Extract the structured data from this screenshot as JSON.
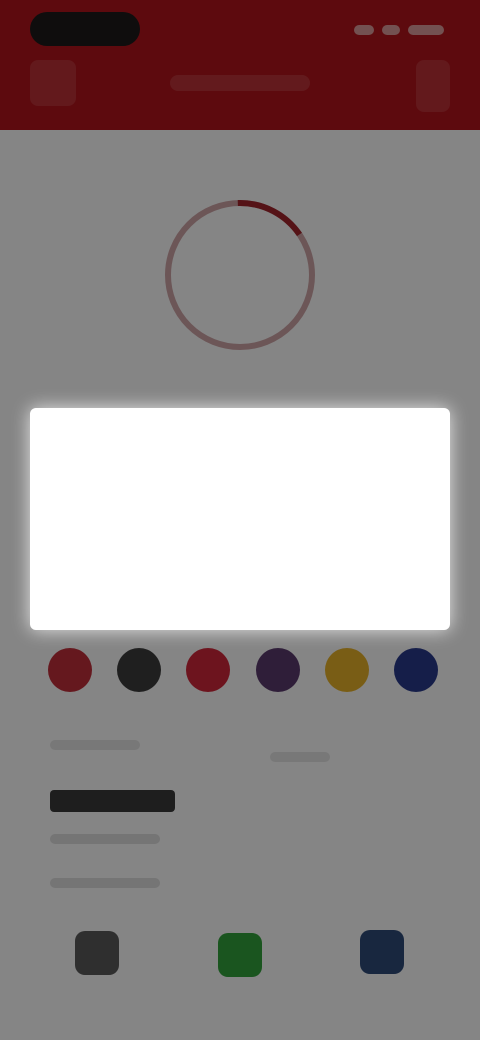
{
  "header": {
    "title": "",
    "back_icon": "back-icon",
    "menu_icon": "menu-icon"
  },
  "main": {
    "progress_ring_icon": "progress-ring-icon",
    "color_swatches": [
      {
        "name": "red",
        "color": "#c12f3a"
      },
      {
        "name": "dark-gray",
        "color": "#3d3d3d"
      },
      {
        "name": "crimson",
        "color": "#d1273a"
      },
      {
        "name": "purple",
        "color": "#5a3a6d"
      },
      {
        "name": "gold",
        "color": "#e8b32a"
      },
      {
        "name": "indigo",
        "color": "#2a3b8d"
      }
    ]
  },
  "dialog": {
    "message": "",
    "cancel_label": "",
    "ok_label": ""
  },
  "colors": {
    "topbar": "#b3151b",
    "accent_green": "#2f9e39",
    "overlay": "rgba(0,0,0,0.48)"
  }
}
